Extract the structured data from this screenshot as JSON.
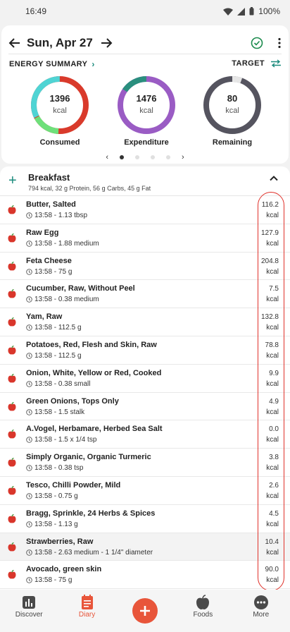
{
  "status_bar": {
    "time": "16:49",
    "battery": "100%"
  },
  "header": {
    "date": "Sun, Apr 27"
  },
  "energy": {
    "title": "ENERGY SUMMARY",
    "target_label": "TARGET",
    "rings": [
      {
        "value": "1396",
        "unit": "kcal",
        "label": "Consumed"
      },
      {
        "value": "1476",
        "unit": "kcal",
        "label": "Expenditure"
      },
      {
        "value": "80",
        "unit": "kcal",
        "label": "Remaining"
      }
    ]
  },
  "meal": {
    "name": "Breakfast",
    "summary": "794 kcal, 32 g Protein, 56 g Carbs, 45 g Fat",
    "items": [
      {
        "name": "Butter, Salted",
        "detail": "13:58 - 1.13 tbsp",
        "kcal": "116.2",
        "unit": "kcal"
      },
      {
        "name": "Raw Egg",
        "detail": "13:58 - 1.88 medium",
        "kcal": "127.9",
        "unit": "kcal"
      },
      {
        "name": "Feta Cheese",
        "detail": "13:58 - 75 g",
        "kcal": "204.8",
        "unit": "kcal"
      },
      {
        "name": "Cucumber, Raw, Without Peel",
        "detail": "13:58 - 0.38 medium",
        "kcal": "7.5",
        "unit": "kcal"
      },
      {
        "name": "Yam, Raw",
        "detail": "13:58 - 112.5 g",
        "kcal": "132.8",
        "unit": "kcal"
      },
      {
        "name": "Potatoes, Red, Flesh and Skin, Raw",
        "detail": "13:58 - 112.5 g",
        "kcal": "78.8",
        "unit": "kcal"
      },
      {
        "name": "Onion, White, Yellow or Red, Cooked",
        "detail": "13:58 - 0.38 small",
        "kcal": "9.9",
        "unit": "kcal"
      },
      {
        "name": "Green Onions, Tops Only",
        "detail": "13:58 - 1.5 stalk",
        "kcal": "4.9",
        "unit": "kcal"
      },
      {
        "name": "A.Vogel, Herbamare, Herbed Sea Salt",
        "detail": "13:58 - 1.5 x 1/4 tsp",
        "kcal": "0.0",
        "unit": "kcal"
      },
      {
        "name": "Simply Organic, Organic Turmeric",
        "detail": "13:58 - 0.38 tsp",
        "kcal": "3.8",
        "unit": "kcal"
      },
      {
        "name": "Tesco, Chilli Powder, Mild",
        "detail": "13:58 - 0.75 g",
        "kcal": "2.6",
        "unit": "kcal"
      },
      {
        "name": "Bragg, Sprinkle, 24 Herbs & Spices",
        "detail": "13:58 - 1.13 g",
        "kcal": "4.5",
        "unit": "kcal"
      },
      {
        "name": "Strawberries, Raw",
        "detail": "13:58 - 2.63 medium - 1 1/4\" diameter",
        "kcal": "10.4",
        "unit": "kcal"
      },
      {
        "name": "Avocado, green skin",
        "detail": "13:58 - 75 g",
        "kcal": "90.0",
        "unit": "kcal"
      }
    ]
  },
  "nav": {
    "discover": "Discover",
    "diary": "Diary",
    "foods": "Foods",
    "more": "More"
  },
  "colors": {
    "accent": "#e8553a",
    "teal": "#1a8a7c",
    "highlight": "#e0322b"
  }
}
